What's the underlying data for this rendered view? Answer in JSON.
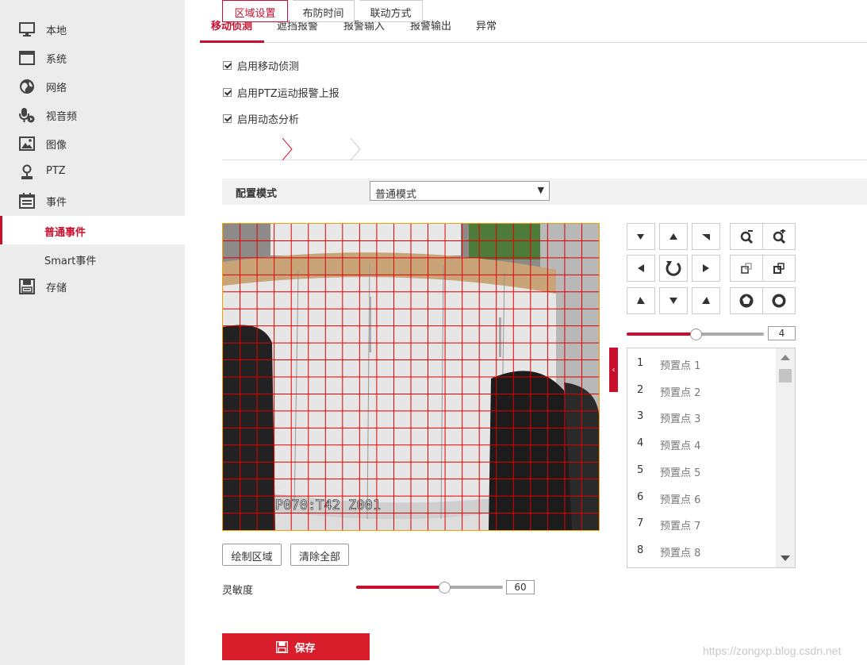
{
  "sidebar": {
    "items": [
      {
        "label": "本地",
        "icon": "monitor-icon"
      },
      {
        "label": "系统",
        "icon": "window-icon"
      },
      {
        "label": "网络",
        "icon": "globe-icon"
      },
      {
        "label": "视音频",
        "icon": "microphone-icon"
      },
      {
        "label": "图像",
        "icon": "image-icon"
      },
      {
        "label": "PTZ",
        "icon": "ptz-icon"
      },
      {
        "label": "事件",
        "icon": "calendar-icon"
      },
      {
        "label": "存储",
        "icon": "save-disk-icon"
      }
    ],
    "sub_items": [
      {
        "label": "普通事件",
        "active": true
      },
      {
        "label": "Smart事件",
        "active": false
      }
    ]
  },
  "tabs": [
    {
      "label": "移动侦测",
      "active": true
    },
    {
      "label": "遮挡报警",
      "active": false
    },
    {
      "label": "报警输入",
      "active": false
    },
    {
      "label": "报警输出",
      "active": false
    },
    {
      "label": "异常",
      "active": false
    }
  ],
  "checkboxes": [
    {
      "label": "启用移动侦测",
      "checked": true
    },
    {
      "label": "启用PTZ运动报警上报",
      "checked": true
    },
    {
      "label": "启用动态分析",
      "checked": true
    }
  ],
  "subtabs": [
    {
      "label": "区域设置",
      "active": true
    },
    {
      "label": "布防时间",
      "active": false
    },
    {
      "label": "联动方式",
      "active": false
    }
  ],
  "config": {
    "label": "配置模式",
    "value": "普通模式"
  },
  "video": {
    "osd_text": "P070:T42  Z001",
    "grid_color": "#e00000",
    "border_color": "#f0a000"
  },
  "buttons": {
    "draw_area": "绘制区域",
    "clear_all": "清除全部"
  },
  "sensitivity": {
    "label": "灵敏度",
    "value": "60",
    "level": 0.6
  },
  "ptz": {
    "speed_value": "4",
    "speed_level": 0.5
  },
  "presets": [
    {
      "num": "1",
      "label": "预置点 1"
    },
    {
      "num": "2",
      "label": "预置点 2"
    },
    {
      "num": "3",
      "label": "预置点 3"
    },
    {
      "num": "4",
      "label": "预置点 4"
    },
    {
      "num": "5",
      "label": "预置点 5"
    },
    {
      "num": "6",
      "label": "预置点 6"
    },
    {
      "num": "7",
      "label": "预置点 7"
    },
    {
      "num": "8",
      "label": "预置点 8"
    }
  ],
  "save_label": "保存",
  "watermark": "https://zongxp.blog.csdn.net",
  "colors": {
    "accent": "#c8102e",
    "save": "#d81e2a"
  }
}
